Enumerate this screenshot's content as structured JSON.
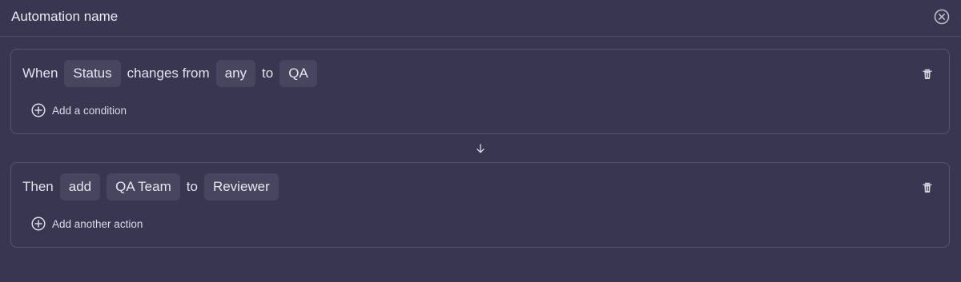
{
  "header": {
    "title": "Automation name",
    "close_icon": "close-circle-icon"
  },
  "trigger": {
    "when_label": "When",
    "field": "Status",
    "changes_from_label": "changes from",
    "from_value": "any",
    "to_label": "to",
    "to_value": "QA",
    "add_condition_label": "Add a condition",
    "delete_icon": "trash-icon",
    "add_icon": "plus-circle-icon"
  },
  "connector": {
    "icon": "arrow-down-icon"
  },
  "action": {
    "then_label": "Then",
    "verb": "add",
    "value": "QA Team",
    "to_label": "to",
    "target": "Reviewer",
    "add_action_label": "Add another action",
    "delete_icon": "trash-icon",
    "add_icon": "plus-circle-icon"
  },
  "colors": {
    "background": "#383650",
    "pill": "#48465f",
    "border": "#55536f",
    "text": "#e7e6ef"
  }
}
